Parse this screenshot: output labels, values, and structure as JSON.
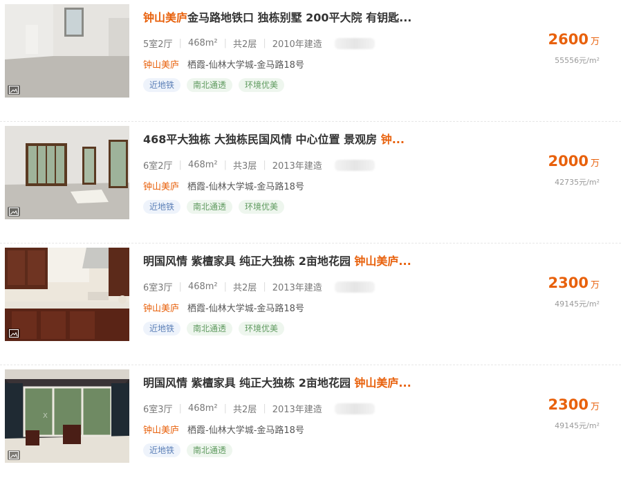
{
  "listings": [
    {
      "title_highlight_prefix": "钟山美庐",
      "title_main": "金马路地铁口 独栋别墅 200平大院 有钥匙...",
      "title_highlight_suffix": "",
      "layout": "5室2厅",
      "area": "468m²",
      "floors": "共2层",
      "built": "2010年建造",
      "community": "钟山美庐",
      "location": "栖霞-仙林大学城-金马路18号",
      "tags": [
        "近地铁",
        "南北通透",
        "环境优美"
      ],
      "price": "2600",
      "price_unit": "万",
      "unit_price": "55556元/m²"
    },
    {
      "title_highlight_prefix": "",
      "title_main": "468平大独栋 大独栋民国风情 中心位置 景观房 ",
      "title_highlight_suffix": "钟...",
      "layout": "6室2厅",
      "area": "468m²",
      "floors": "共3层",
      "built": "2013年建造",
      "community": "钟山美庐",
      "location": "栖霞-仙林大学城-金马路18号",
      "tags": [
        "近地铁",
        "南北通透",
        "环境优美"
      ],
      "price": "2000",
      "price_unit": "万",
      "unit_price": "42735元/m²"
    },
    {
      "title_highlight_prefix": "",
      "title_main": "明国风情 紫檀家具 纯正大独栋 2亩地花园 ",
      "title_highlight_suffix": "钟山美庐...",
      "layout": "6室3厅",
      "area": "468m²",
      "floors": "共2层",
      "built": "2013年建造",
      "community": "钟山美庐",
      "location": "栖霞-仙林大学城-金马路18号",
      "tags": [
        "近地铁",
        "南北通透",
        "环境优美"
      ],
      "price": "2300",
      "price_unit": "万",
      "unit_price": "49145元/m²"
    },
    {
      "title_highlight_prefix": "",
      "title_main": "明国风情 紫檀家具 纯正大独栋 2亩地花园 ",
      "title_highlight_suffix": "钟山美庐...",
      "layout": "6室3厅",
      "area": "468m²",
      "floors": "共2层",
      "built": "2013年建造",
      "community": "钟山美庐",
      "location": "栖霞-仙林大学城-金马路18号",
      "tags": [
        "近地铁",
        "南北通透"
      ],
      "price": "2300",
      "price_unit": "万",
      "unit_price": "49145元/m²"
    }
  ],
  "colors": {
    "accent": "#e8610c",
    "tag_blue_bg": "#eef3fb",
    "tag_green_bg": "#eef6ee"
  }
}
